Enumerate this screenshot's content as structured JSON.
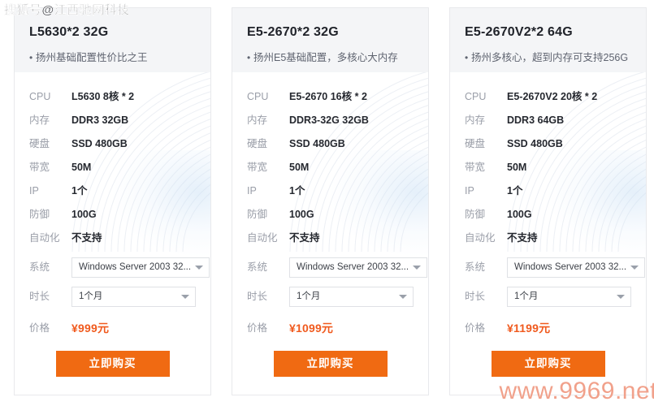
{
  "watermarks": {
    "top_left": "搜狐号@江西驰网科技",
    "bottom_right": "www.9969.net",
    "bottom_right_color": "#f09a82"
  },
  "theme": {
    "accent_orange": "#f06a12",
    "price_color": "#f05a1e",
    "header_bg": "#f4f5f7",
    "card_border": "#e8e9ec"
  },
  "labels": {
    "cpu": "CPU",
    "memory": "内存",
    "disk": "硬盘",
    "bandwidth": "带宽",
    "ip": "IP",
    "defense": "防御",
    "automation": "自动化",
    "system": "系统",
    "duration": "时长",
    "price": "价格",
    "bullet": "•"
  },
  "cards": [
    {
      "title": "L5630*2 32G",
      "subtitle": "扬州基础配置性价比之王",
      "cpu": "L5630 8核 * 2",
      "memory": "DDR3 32GB",
      "disk": "SSD 480GB",
      "bandwidth": "50M",
      "ip": "1个",
      "defense": "100G",
      "automation": "不支持",
      "system_value": "Windows Server 2003 32...",
      "duration_value": "1个月",
      "price": "¥999元",
      "buy_label": "立即购买"
    },
    {
      "title": "E5-2670*2 32G",
      "subtitle": "扬州E5基础配置，多核心大内存",
      "cpu": "E5-2670 16核 * 2",
      "memory": "DDR3-32G 32GB",
      "disk": "SSD 480GB",
      "bandwidth": "50M",
      "ip": "1个",
      "defense": "100G",
      "automation": "不支持",
      "system_value": "Windows Server 2003 32...",
      "duration_value": "1个月",
      "price": "¥1099元",
      "buy_label": "立即购买"
    },
    {
      "title": "E5-2670V2*2 64G",
      "subtitle": "扬州多核心，超到内存可支持256G",
      "cpu": "E5-2670V2 20核 * 2",
      "memory": "DDR3 64GB",
      "disk": "SSD 480GB",
      "bandwidth": "50M",
      "ip": "1个",
      "defense": "100G",
      "automation": "不支持",
      "system_value": "Windows Server 2003 32...",
      "duration_value": "1个月",
      "price": "¥1199元",
      "buy_label": "立即购买"
    }
  ]
}
